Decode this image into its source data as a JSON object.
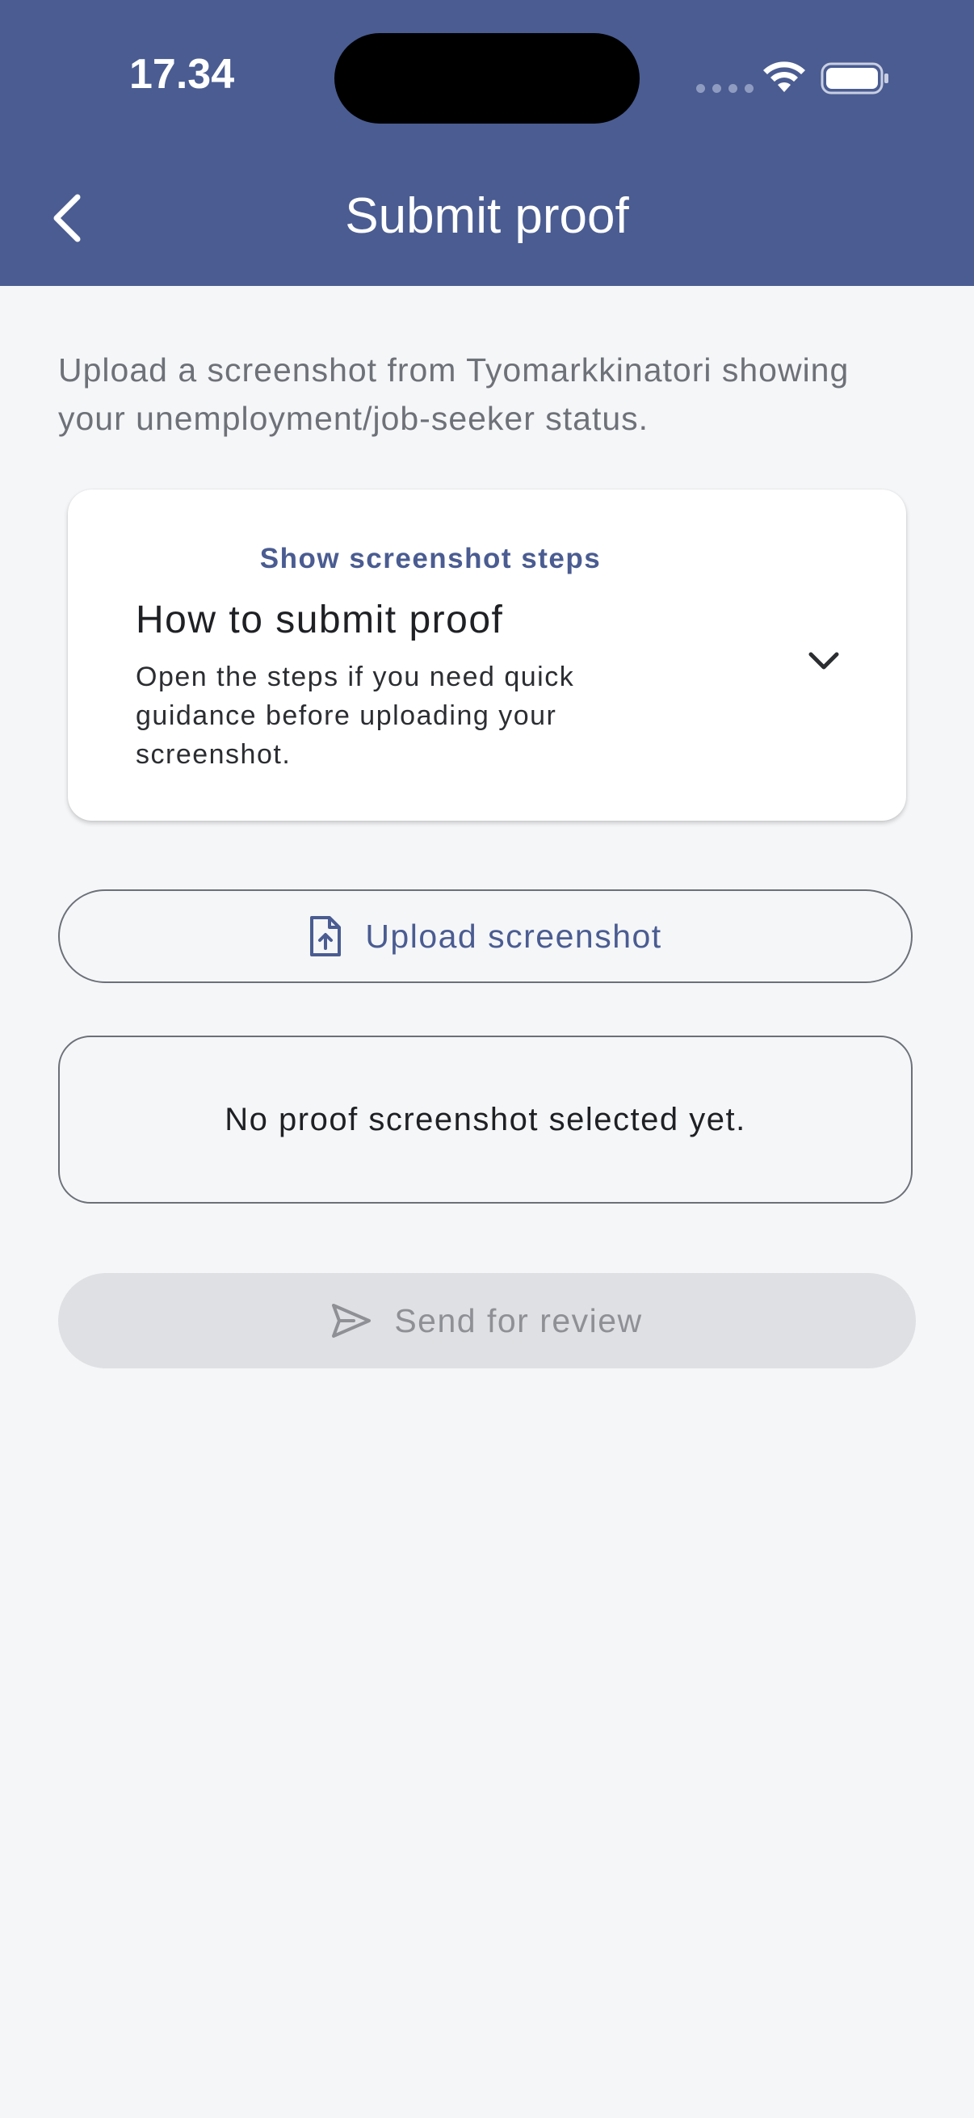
{
  "status_bar": {
    "time": "17.34"
  },
  "header": {
    "title": "Submit proof",
    "back_icon": "chevron-left-icon",
    "background_color": "#4a5c91"
  },
  "intro": {
    "text": "Upload a screenshot from Tyomarkkinatori showing your unemployment/job-seeker status."
  },
  "steps_card": {
    "eyebrow": "Show screenshot steps",
    "title": "How to submit proof",
    "description": "Open the steps if you need quick guidance before uploading your screenshot.",
    "expand_icon": "chevron-down-icon",
    "expanded": false
  },
  "upload": {
    "label": "Upload screenshot",
    "icon": "file-upload-icon"
  },
  "selection_status": {
    "text": "No proof screenshot selected yet."
  },
  "send": {
    "label": "Send for review",
    "icon": "send-icon",
    "disabled": true
  },
  "colors": {
    "accent": "#4a5c91",
    "background": "#f5f6f8",
    "disabled_bg": "#dfe0e3",
    "disabled_text": "#8e9096"
  }
}
